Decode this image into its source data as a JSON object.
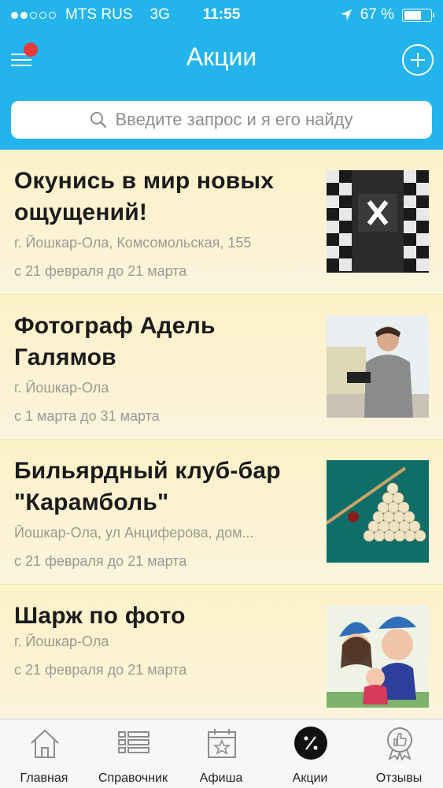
{
  "status_bar": {
    "carrier": "MTS RUS",
    "network": "3G",
    "time": "11:55",
    "battery": "67 %",
    "battery_level": 0.67
  },
  "navbar": {
    "title": "Акции",
    "menu_icon": "hamburger-icon",
    "add_icon": "plus-circle-icon"
  },
  "search": {
    "placeholder": "Введите запрос и я его найду",
    "icon": "search-icon"
  },
  "deals": [
    {
      "title": "Окунись в мир новых ощущений!",
      "place": "г. Йошкар-Ола, Комсомольская, 155",
      "dates": "с 21 февраля до 21 марта",
      "image": "escape-room-photo"
    },
    {
      "title": "Фотограф Адель Галямов",
      "place": "г. Йошкар-Ола",
      "dates": "с 1 марта до 31 марта",
      "image": "photographer-photo"
    },
    {
      "title": "Бильярдный клуб-бар \"Карамболь\"",
      "place": "Йошкар-Ола, ул Анциферова, дом...",
      "dates": "с 21 февраля до 21 марта",
      "image": "billiard-balls-photo"
    },
    {
      "title": "Шарж по фото",
      "place": "г. Йошкар-Ола",
      "dates": "с 21 февраля до 21 марта",
      "image": "caricature-drawing"
    }
  ],
  "tabs": [
    {
      "label": "Главная",
      "icon": "house-icon",
      "active": false
    },
    {
      "label": "Справочник",
      "icon": "list-icon",
      "active": false
    },
    {
      "label": "Афиша",
      "icon": "calendar-star-icon",
      "active": false
    },
    {
      "label": "Акции",
      "icon": "percent-icon",
      "active": true
    },
    {
      "label": "Отзывы",
      "icon": "thumbs-up-badge-icon",
      "active": false
    }
  ],
  "colors": {
    "header": "#23b4ec",
    "list_background": "#fbf2d2",
    "badge": "#e63b3b"
  }
}
